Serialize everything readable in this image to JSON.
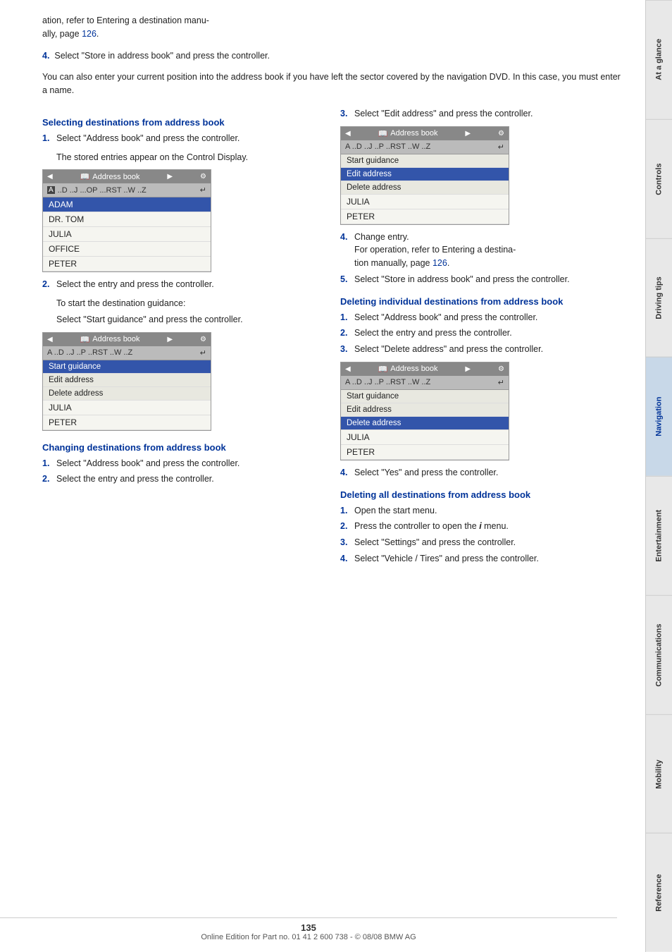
{
  "intro": {
    "line1": "ation, refer to Entering a destination manu-",
    "line2": "ally, page ",
    "line2_link": "126",
    "line2_end": ".",
    "step4_label": "4.",
    "step4_text": "Select \"Store in address book\" and press the controller.",
    "note": "You can also enter your current position into the address book if you have left the sector covered by the navigation DVD. In this case, you must enter a name."
  },
  "sections": {
    "selecting": {
      "heading": "Selecting destinations from address book",
      "step1_num": "1.",
      "step1_text": "Select \"Address book\" and press the controller.",
      "step1_sub": "The stored entries appear on the Control Display.",
      "widget1": {
        "title": "Address book",
        "search_bar": "A ..D ..J ...OP ...RST ..W ..Z",
        "cursor_char": "A",
        "entries": [
          "ADAM",
          "DR. TOM",
          "JULIA",
          "OFFICE",
          "PETER"
        ],
        "highlighted": "ADAM"
      },
      "step2_num": "2.",
      "step2_text": "Select the entry and press the controller.",
      "step2_sub1": "To start the destination guidance:",
      "step2_sub2": "Select \"Start guidance\" and press the controller.",
      "widget2": {
        "title": "Address book",
        "search_bar": "A ..D ..J ..P ..RST ..W ..Z",
        "menu_items": [
          "Start guidance",
          "Edit address",
          "Delete address"
        ],
        "entries": [
          "JULIA",
          "PETER"
        ],
        "selected_menu": "Start guidance"
      }
    },
    "changing": {
      "heading": "Changing destinations from address book",
      "step1_num": "1.",
      "step1_text": "Select \"Address book\" and press the controller.",
      "step2_num": "2.",
      "step2_text": "Select the entry and press the controller."
    },
    "editing_right": {
      "step3_num": "3.",
      "step3_text": "Select \"Edit address\" and press the controller.",
      "widget3": {
        "title": "Address book",
        "search_bar": "A ..D ..J ..P ..RST ..W ..Z",
        "menu_items": [
          "Start guidance",
          "Edit address",
          "Delete address"
        ],
        "entries": [
          "JULIA",
          "PETER"
        ],
        "selected_menu": "Edit address"
      },
      "step4_num": "4.",
      "step4_text": "Change entry.",
      "step4_sub1": "For operation, refer to Entering a destina-",
      "step4_sub2": "tion manually, page ",
      "step4_link": "126",
      "step4_end": ".",
      "step5_num": "5.",
      "step5_text": "Select \"Store in address book\" and press the controller."
    },
    "deleting_individual": {
      "heading": "Deleting individual destinations from address book",
      "step1_num": "1.",
      "step1_text": "Select \"Address book\" and press the controller.",
      "step2_num": "2.",
      "step2_text": "Select the entry and press the controller.",
      "step3_num": "3.",
      "step3_text": "Select \"Delete address\" and press the controller.",
      "widget4": {
        "title": "Address book",
        "search_bar": "A ..D ..J ..P ..RST ..W ..Z",
        "menu_items": [
          "Start guidance",
          "Edit address",
          "Delete address"
        ],
        "entries": [
          "JULIA",
          "PETER"
        ],
        "selected_menu": "Delete address"
      },
      "step4_num": "4.",
      "step4_text": "Select \"Yes\" and press the controller."
    },
    "deleting_all": {
      "heading": "Deleting all destinations from address book",
      "step1_num": "1.",
      "step1_text": "Open the start menu.",
      "step2_num": "2.",
      "step2_text": "Press the controller to open the ",
      "step2_icon": "i",
      "step2_end": " menu.",
      "step3_num": "3.",
      "step3_text": "Select \"Settings\" and press the controller.",
      "step4_num": "4.",
      "step4_text": "Select \"Vehicle / Tires\" and press the controller."
    }
  },
  "footer": {
    "page_number": "135",
    "edition_text": "Online Edition for Part no. 01 41 2 600 738 - © 08/08 BMW AG"
  },
  "sidebar": {
    "tabs": [
      "At a glance",
      "Controls",
      "Driving tips",
      "Navigation",
      "Entertainment",
      "Communications",
      "Mobility",
      "Reference"
    ]
  }
}
